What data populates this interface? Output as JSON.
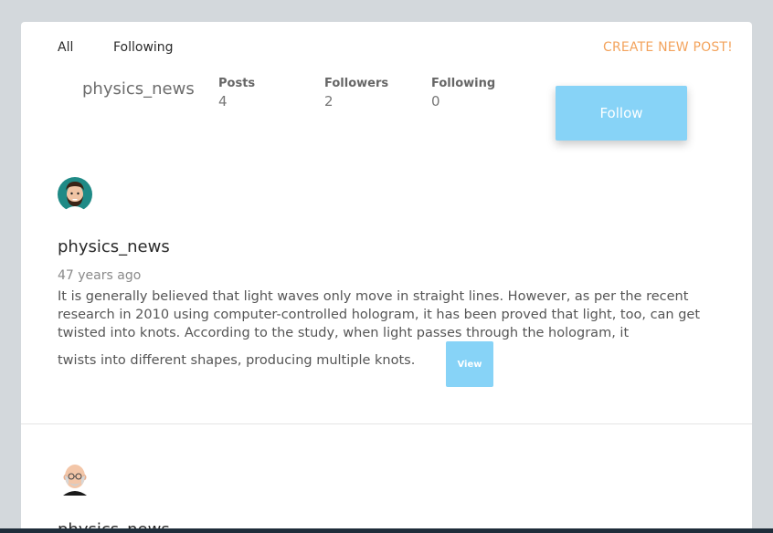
{
  "nav": {
    "tabs": [
      {
        "label": "All"
      },
      {
        "label": "Following"
      }
    ],
    "create_post_label": "CREATE NEW POST!"
  },
  "profile": {
    "username": "physics_news",
    "stats": [
      {
        "label": "Posts",
        "value": "4"
      },
      {
        "label": "Followers",
        "value": "2"
      },
      {
        "label": "Following",
        "value": "0"
      }
    ],
    "follow_label": "Follow"
  },
  "posts": [
    {
      "author": "physics_news",
      "avatar_icon": "bearded-man-avatar-icon",
      "time": "47 years ago",
      "body": "It is generally believed that light waves only move in straight lines. However, as per the recent research in 2010 using computer-controlled hologram, it has been proved that light, too, can get twisted into knots. According to the study, when light passes through the hologram, it",
      "body_end": "twists into different shapes, producing multiple knots.",
      "view_label": "View"
    },
    {
      "author": "physics_news",
      "avatar_icon": "bald-man-glasses-avatar-icon"
    }
  ],
  "colors": {
    "accent_button": "#87d3f7",
    "create_link": "#f3a35c",
    "page_background": "#d3d8dc"
  }
}
